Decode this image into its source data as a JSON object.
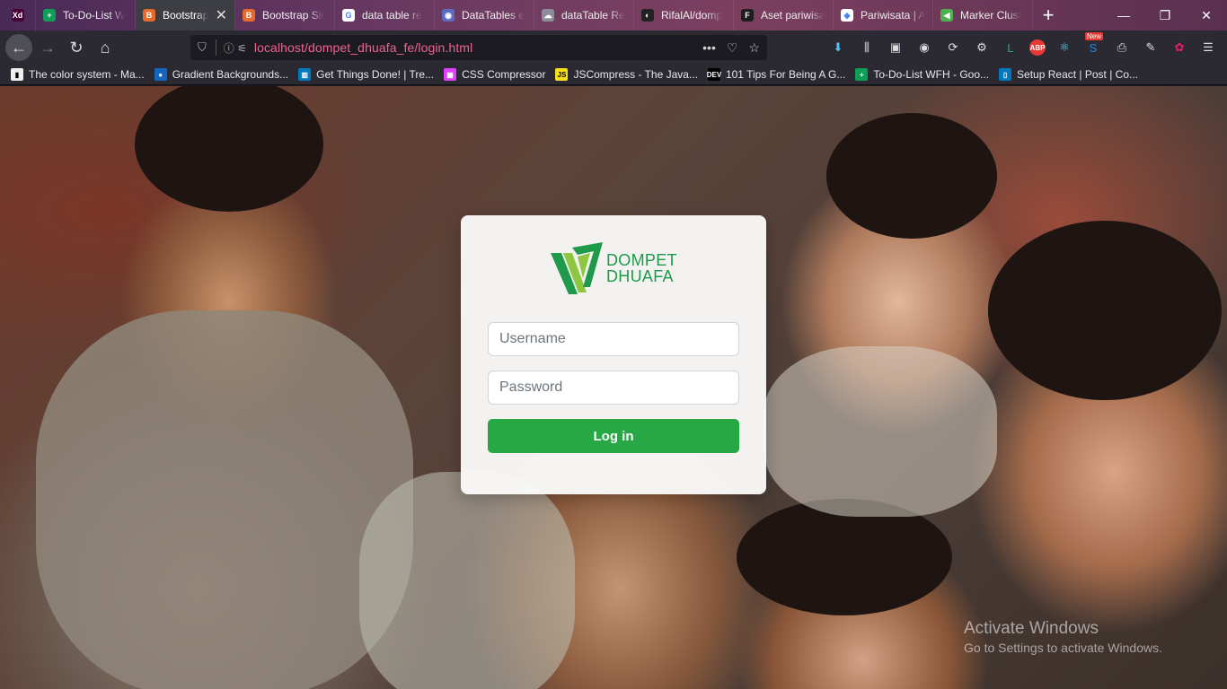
{
  "browser": {
    "tabs": [
      {
        "label": "",
        "icon": "adobe-xd-icon",
        "color": "#470137",
        "glyph": "Xd"
      },
      {
        "label": "To-Do-List W",
        "icon": "plus-icon",
        "color": "#0f9d58",
        "glyph": "+"
      },
      {
        "label": "Bootstrap",
        "icon": "bootstrap-icon",
        "color": "#e66a2c",
        "glyph": "B",
        "active": true
      },
      {
        "label": "Bootstrap Sir",
        "icon": "bootstrap-icon",
        "color": "#e66a2c",
        "glyph": "B"
      },
      {
        "label": "data table re",
        "icon": "google-icon",
        "color": "#ffffff",
        "glyph": "G"
      },
      {
        "label": "DataTables e",
        "icon": "datatables-icon",
        "color": "#5c6bc0",
        "glyph": "◉"
      },
      {
        "label": "dataTable Re",
        "icon": "cloud-icon",
        "color": "#8e8e9a",
        "glyph": "☁"
      },
      {
        "label": "RifalAl/domp",
        "icon": "github-icon",
        "color": "#222222",
        "glyph": "◐"
      },
      {
        "label": "Aset pariwisa",
        "icon": "figma-icon",
        "color": "#1e1e1e",
        "glyph": "F"
      },
      {
        "label": "Pariwisata | A",
        "icon": "app-icon",
        "color": "#ffffff",
        "glyph": "◆"
      },
      {
        "label": "Marker Clust",
        "icon": "marker-icon",
        "color": "#4caf50",
        "glyph": "◀"
      }
    ],
    "url": "localhost/dompet_dhuafa_fe/login.html",
    "url_actions": [
      "•••",
      "♡",
      "☆"
    ],
    "toolbar_icons": [
      {
        "name": "download-icon",
        "glyph": "⬇",
        "color": "#4fc3f7"
      },
      {
        "name": "library-icon",
        "glyph": "⫼",
        "color": "#dcdcde"
      },
      {
        "name": "reader-view-icon",
        "glyph": "▣",
        "color": "#dcdcde"
      },
      {
        "name": "account-icon",
        "glyph": "◉",
        "color": "#dcdcde"
      },
      {
        "name": "sync-icon",
        "glyph": "⟳",
        "color": "#dcdcde"
      },
      {
        "name": "settings-gear-icon",
        "glyph": "⚙",
        "color": "#dcdcde"
      },
      {
        "name": "extension-l-icon",
        "glyph": "L",
        "color": "#26a69a"
      },
      {
        "name": "adblock-icon",
        "glyph": "ABP",
        "color": "#e53935"
      },
      {
        "name": "react-devtools-icon",
        "glyph": "⚛",
        "color": "#61dafb"
      },
      {
        "name": "new-extension-icon",
        "glyph": "S",
        "color": "#1e88e5",
        "badge": "New"
      },
      {
        "name": "print-icon",
        "glyph": "⎙",
        "color": "#dcdcde"
      },
      {
        "name": "pen-icon",
        "glyph": "✎",
        "color": "#dcdcde"
      },
      {
        "name": "color-wheel-icon",
        "glyph": "✿",
        "color": "#e91e63"
      },
      {
        "name": "menu-icon",
        "glyph": "☰",
        "color": "#dcdcde"
      }
    ],
    "bookmarks": [
      {
        "label": "The color system - Ma...",
        "color": "#eeeeee",
        "glyph": "▮"
      },
      {
        "label": "Gradient Backgrounds...",
        "color": "#1565c0",
        "glyph": "●"
      },
      {
        "label": "Get Things Done! | Tre...",
        "color": "#0079bf",
        "glyph": "▥"
      },
      {
        "label": "CSS Compressor",
        "color": "#e040fb",
        "glyph": "▦"
      },
      {
        "label": "JSCompress - The Java...",
        "color": "#f7df1e",
        "glyph": "JS"
      },
      {
        "label": "101 Tips For Being A G...",
        "color": "#000000",
        "glyph": "DEV"
      },
      {
        "label": "To-Do-List WFH - Goo...",
        "color": "#0f9d58",
        "glyph": "+"
      },
      {
        "label": "Setup React | Post | Co...",
        "color": "#0277bd",
        "glyph": "▯"
      }
    ]
  },
  "login": {
    "brand_line1": "DOMPET",
    "brand_line2": "DHUAFA",
    "username_placeholder": "Username",
    "password_placeholder": "Password",
    "submit_label": "Log in",
    "colors": {
      "primary": "#28a745",
      "brand_green": "#1f9a4a",
      "brand_lime": "#8dc63f"
    }
  },
  "watermark": {
    "title": "Activate Windows",
    "subtitle": "Go to Settings to activate Windows."
  }
}
